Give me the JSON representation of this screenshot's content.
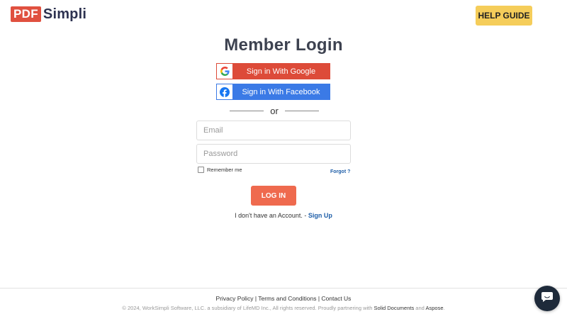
{
  "header": {
    "logo_box": "PDF",
    "logo_text": "Simpli",
    "help_label": "HELP GUIDE"
  },
  "login": {
    "title": "Member Login",
    "google_label": "Sign in With Google",
    "facebook_label": "Sign in With Facebook",
    "or_text": "or",
    "email_placeholder": "Email",
    "password_placeholder": "Password",
    "remember_label": "Remember me",
    "forgot_label": "Forgot ?",
    "login_label": "LOG IN",
    "no_account_text": "I don't have an Account. - ",
    "signup_label": "Sign Up"
  },
  "footer": {
    "privacy": "Privacy Policy",
    "terms": "Terms and Conditions",
    "contact": "Contact Us",
    "separator": " | ",
    "copyright_prefix": "© 2024, WorkSimpli Software, LLC. a subsidiary of LifeMD Inc., All rights reserved. Proudly partnering with ",
    "partner1": "Solid Documents",
    "and_text": " and ",
    "partner2": "Aspose",
    "period": "."
  },
  "colors": {
    "brand_red": "#e0503f",
    "help_yellow": "#f5cd5a",
    "google_red": "#dd4b39",
    "facebook_blue": "#3b7ae6",
    "login_orange": "#ef6a4e",
    "link_blue": "#1e5ea8"
  },
  "icons": {
    "google": "google-icon",
    "facebook": "facebook-icon",
    "chat": "chat-icon"
  }
}
